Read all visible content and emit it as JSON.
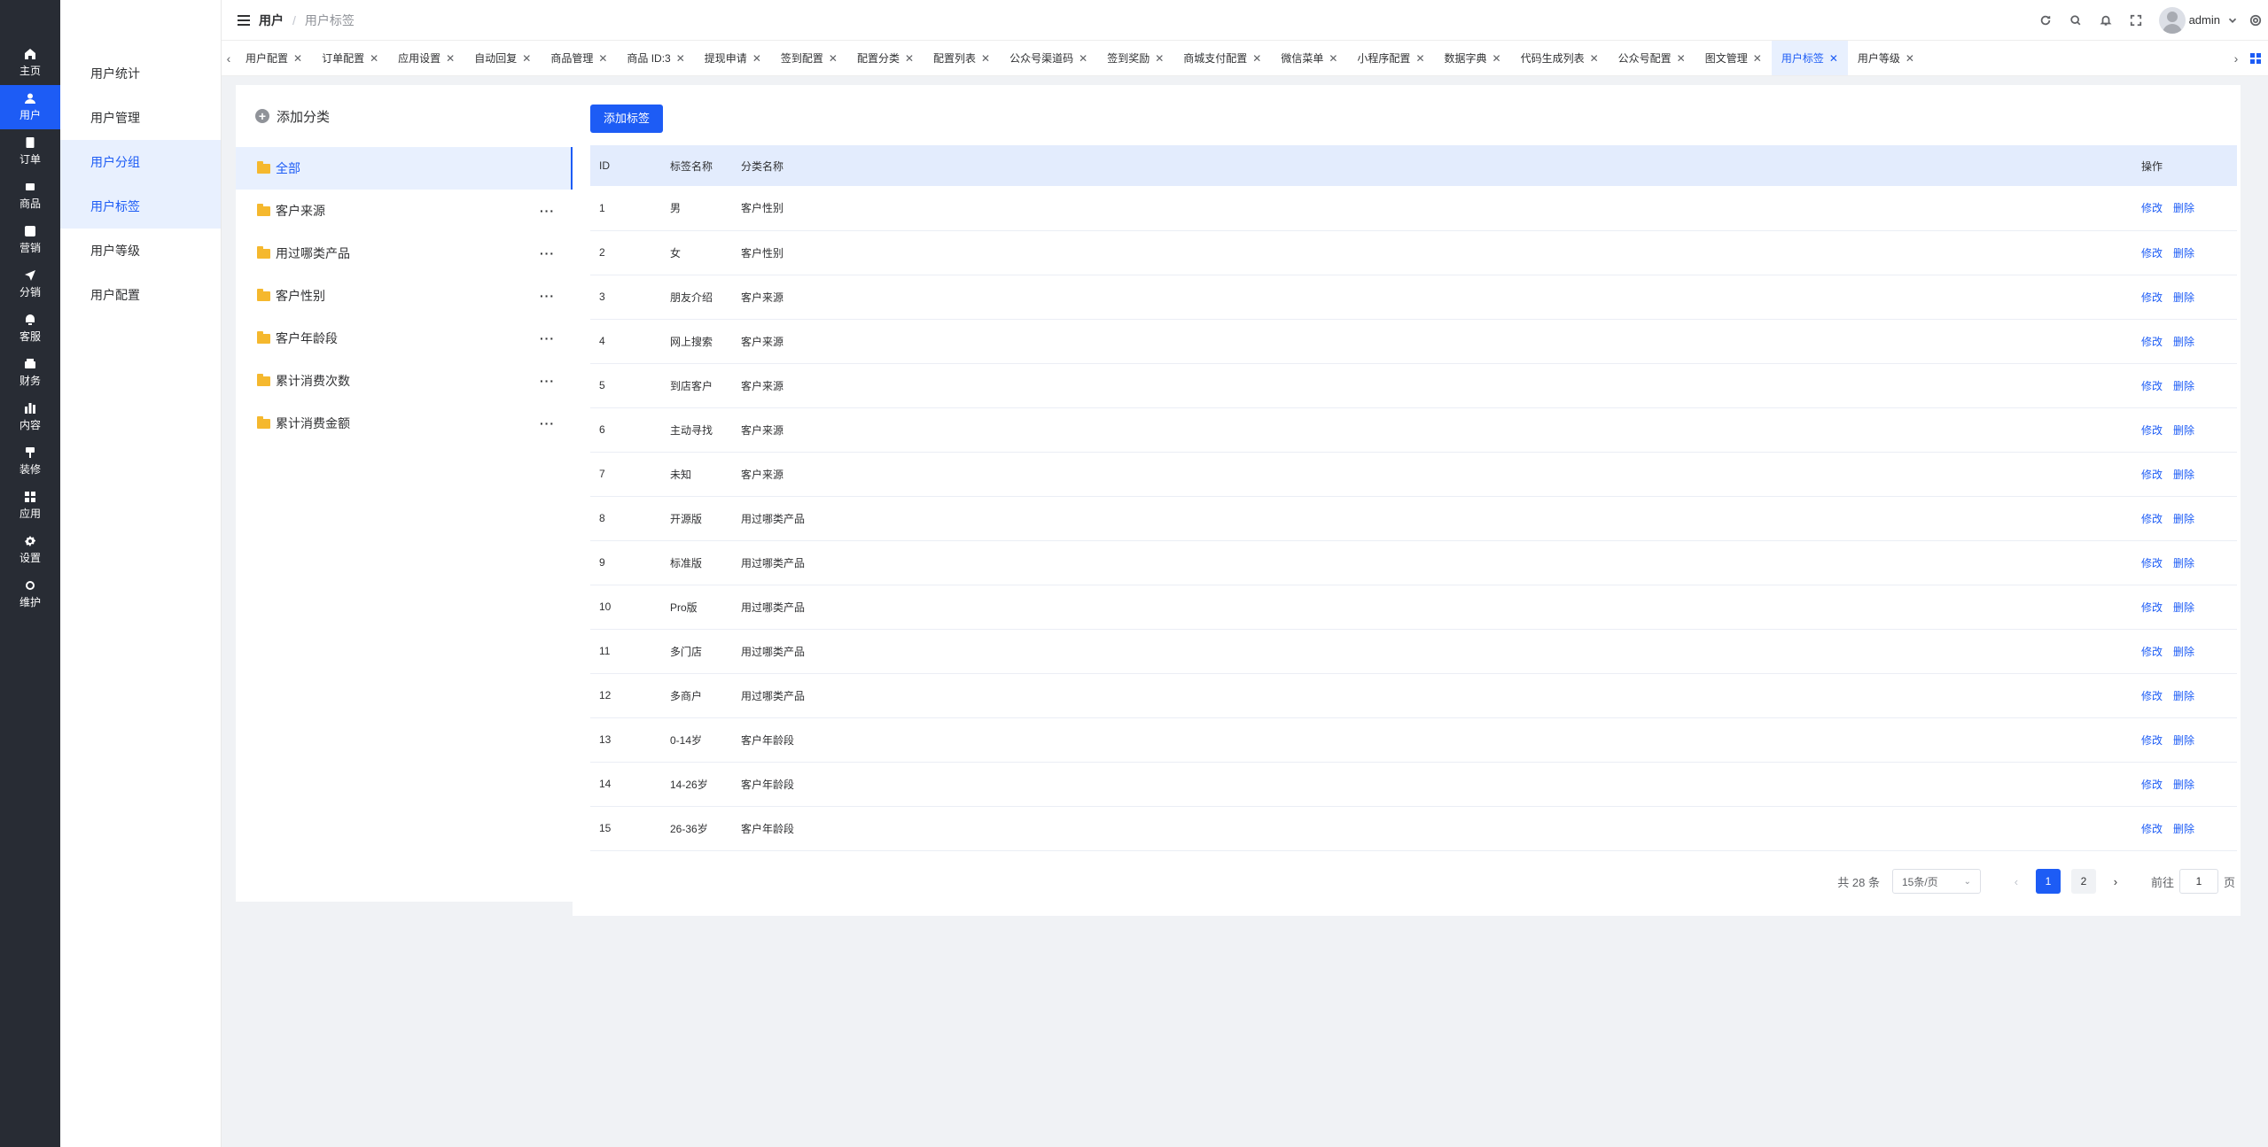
{
  "rail": {
    "items": [
      {
        "label": "主页",
        "icon": "home-icon"
      },
      {
        "label": "用户",
        "icon": "user-icon"
      },
      {
        "label": "订单",
        "icon": "order-icon"
      },
      {
        "label": "商品",
        "icon": "goods-icon"
      },
      {
        "label": "营销",
        "icon": "marketing-icon"
      },
      {
        "label": "分销",
        "icon": "distribution-icon"
      },
      {
        "label": "客服",
        "icon": "service-icon"
      },
      {
        "label": "财务",
        "icon": "finance-icon"
      },
      {
        "label": "内容",
        "icon": "content-icon"
      },
      {
        "label": "装修",
        "icon": "decorate-icon"
      },
      {
        "label": "应用",
        "icon": "apps-icon"
      },
      {
        "label": "设置",
        "icon": "settings-icon"
      },
      {
        "label": "维护",
        "icon": "maintain-icon"
      }
    ],
    "active_index": 1,
    "accent": "#1d5cf5",
    "background": "#282c34"
  },
  "submenu": {
    "items": [
      "用户统计",
      "用户管理",
      "用户分组",
      "用户标签",
      "用户等级",
      "用户配置"
    ]
  },
  "header": {
    "breadcrumb_parent": "用户",
    "breadcrumb_current": "用户标签",
    "user_name": "admin"
  },
  "tabs": {
    "items": [
      "用户配置",
      "订单配置",
      "应用设置",
      "自动回复",
      "商品管理",
      "商品 ID:3",
      "提现申请",
      "签到配置",
      "配置分类",
      "配置列表",
      "公众号渠道码",
      "签到奖励",
      "商城支付配置",
      "微信菜单",
      "小程序配置",
      "数据字典",
      "代码生成列表",
      "公众号配置",
      "图文管理",
      "用户标签",
      "用户等级"
    ],
    "active_index": 19
  },
  "categories": {
    "add_label": "添加分类",
    "items": [
      "全部",
      "客户来源",
      "用过哪类产品",
      "客户性别",
      "客户年龄段",
      "累计消费次数",
      "累计消费金额"
    ]
  },
  "table": {
    "add_button": "添加标签",
    "headers": {
      "id": "ID",
      "name": "标签名称",
      "category": "分类名称",
      "ops": "操作"
    },
    "edit_label": "修改",
    "delete_label": "删除",
    "rows": [
      {
        "id": "1",
        "name": "男",
        "category": "客户性别"
      },
      {
        "id": "2",
        "name": "女",
        "category": "客户性别"
      },
      {
        "id": "3",
        "name": "朋友介绍",
        "category": "客户来源"
      },
      {
        "id": "4",
        "name": "网上搜索",
        "category": "客户来源"
      },
      {
        "id": "5",
        "name": "到店客户",
        "category": "客户来源"
      },
      {
        "id": "6",
        "name": "主动寻找",
        "category": "客户来源"
      },
      {
        "id": "7",
        "name": "未知",
        "category": "客户来源"
      },
      {
        "id": "8",
        "name": "开源版",
        "category": "用过哪类产品"
      },
      {
        "id": "9",
        "name": "标准版",
        "category": "用过哪类产品"
      },
      {
        "id": "10",
        "name": "Pro版",
        "category": "用过哪类产品"
      },
      {
        "id": "11",
        "name": "多门店",
        "category": "用过哪类产品"
      },
      {
        "id": "12",
        "name": "多商户",
        "category": "用过哪类产品"
      },
      {
        "id": "13",
        "name": "0-14岁",
        "category": "客户年龄段"
      },
      {
        "id": "14",
        "name": "14-26岁",
        "category": "客户年龄段"
      },
      {
        "id": "15",
        "name": "26-36岁",
        "category": "客户年龄段"
      }
    ]
  },
  "pagination": {
    "total_text": "共 28 条",
    "page_size": "15条/页",
    "pages": [
      "1",
      "2"
    ],
    "current_page": "1",
    "goto_label": "前往",
    "goto_value": "1",
    "page_suffix": "页"
  }
}
